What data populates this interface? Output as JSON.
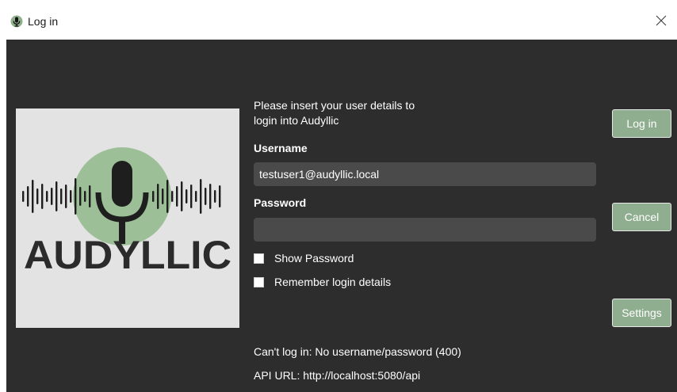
{
  "window": {
    "title": "Log in",
    "icon": "microphone-icon",
    "close_icon": "close-icon"
  },
  "colors": {
    "background": "#2d2d2d",
    "accent": "#8fad8f",
    "input_bg": "#4a4a4a",
    "logo_bg": "#e3e3e3",
    "logo_circle": "#9cbf98"
  },
  "logo": {
    "text": "AUDYLLIC"
  },
  "form": {
    "instructions_line1": "Please insert your user details to",
    "instructions_line2": "login into Audyllic",
    "username_label": "Username",
    "username_value": "testuser1@audyllic.local",
    "password_label": "Password",
    "password_value": "",
    "show_password_label": "Show Password",
    "remember_label": "Remember login details"
  },
  "buttons": {
    "login": "Log in",
    "cancel": "Cancel",
    "settings": "Settings"
  },
  "status": {
    "message": "Can't log in: No username/password (400)",
    "api_url": "API URL: http://localhost:5080/api"
  }
}
